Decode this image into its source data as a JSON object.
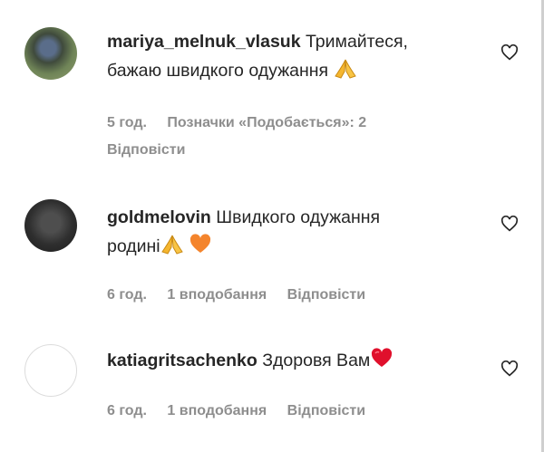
{
  "comments": [
    {
      "username": "mariya_melnuk_vlasuk",
      "text_line1": "Тримайтеся,",
      "text_line2": "бажаю швидкого одужання",
      "emoji": "pray-emoji",
      "time": "5 год.",
      "likes": "Позначки «Подобається»: 2",
      "reply": "Відповісти",
      "avatar": "photo-avatar-green"
    },
    {
      "username": "goldmelovin",
      "text_line1": "Швидкого одужання",
      "text_line2": "родині",
      "emoji": "pray-and-orange-heart-emoji",
      "time": "6 год.",
      "likes": "1 вподобання",
      "reply": "Відповісти",
      "avatar": "photo-avatar-dark"
    },
    {
      "username": "katiagritsachenko",
      "text_line1": "Здоровя Вам",
      "emoji": "red-heart-emoji",
      "time": "6 год.",
      "likes": "1 вподобання",
      "reply": "Відповісти",
      "avatar": "empty-avatar"
    }
  ],
  "icons": {
    "like": "heart-outline-icon"
  },
  "colors": {
    "text": "#262626",
    "meta": "#8e8e8e",
    "orange_heart": "#f4842c",
    "red_heart": "#e0102c",
    "pray": "#f5b62f"
  }
}
